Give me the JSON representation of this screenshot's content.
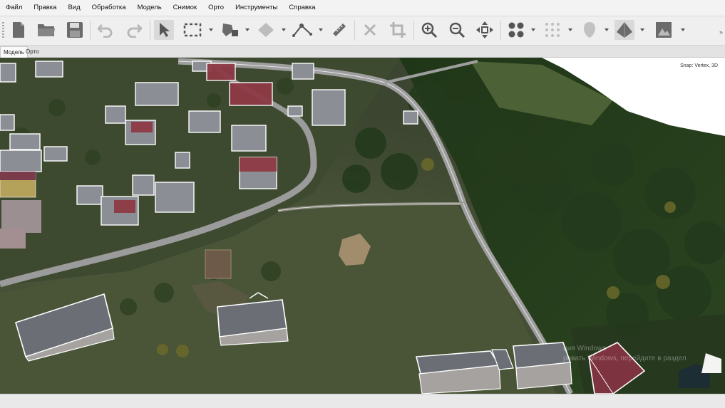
{
  "menu": {
    "items": [
      "Файл",
      "Правка",
      "Вид",
      "Обработка",
      "Модель",
      "Снимок",
      "Орто",
      "Инструменты",
      "Справка"
    ]
  },
  "toolbar": {
    "icons": [
      "new-document-icon",
      "open-folder-icon",
      "save-icon",
      "undo-icon",
      "redo-icon",
      "navigation-arrow-icon",
      "rectangle-selection-icon",
      "draw-polygon-icon",
      "draw-shape-icon",
      "draw-polyline-icon",
      "ruler-icon",
      "delete-icon",
      "crop-icon",
      "zoom-in-icon",
      "zoom-out-icon",
      "move-icon",
      "point-cloud-icon",
      "sparse-cloud-icon",
      "tiled-model-icon",
      "model-icon",
      "orthomosaic-icon"
    ],
    "active": "navigation-arrow-icon"
  },
  "tabs": [
    {
      "label": "Модель",
      "selected": true
    },
    {
      "label": "Орто",
      "selected": false
    }
  ],
  "viewport": {
    "snap_label": "Snap: Vertex, 3D",
    "watermark_line1": "ция Windows",
    "watermark_line2": "ровать Windows, перейдите в раздел"
  },
  "colors": {
    "terrain_dark": "#2f3a25",
    "terrain_mid": "#4a5637",
    "forest": "#233a1c",
    "road": "#8f8f8f",
    "roof_red": "#8e3a45",
    "outline": "#ffffff"
  }
}
